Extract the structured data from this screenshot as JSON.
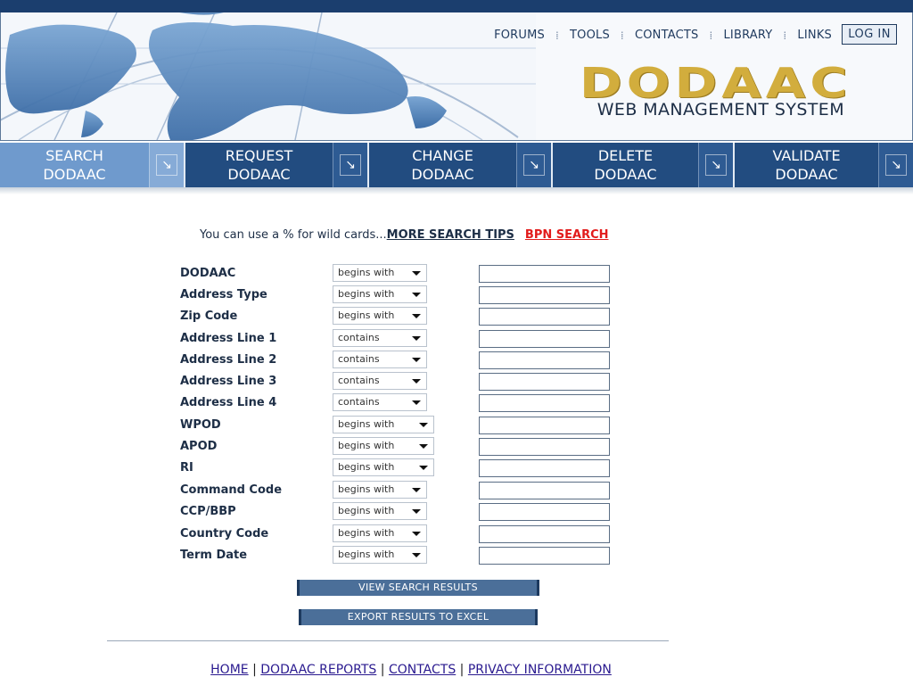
{
  "header": {
    "nav": [
      "FORUMS",
      "TOOLS",
      "CONTACTS",
      "LIBRARY",
      "LINKS"
    ],
    "login_label": "LOG IN",
    "brand": "DODAAC",
    "brand_subtitle": "WEB MANAGEMENT SYSTEM"
  },
  "tabs": [
    {
      "line1": "SEARCH",
      "line2": "DODAAC",
      "active": true
    },
    {
      "line1": "REQUEST",
      "line2": "DODAAC",
      "active": false
    },
    {
      "line1": "CHANGE",
      "line2": "DODAAC",
      "active": false
    },
    {
      "line1": "DELETE",
      "line2": "DODAAC",
      "active": false
    },
    {
      "line1": "VALIDATE",
      "line2": "DODAAC",
      "active": false
    }
  ],
  "search": {
    "tip_text": "You can use a % for wild cards...",
    "more_tips_link": "MORE SEARCH TIPS",
    "bpn_link": "BPN SEARCH",
    "fields": [
      {
        "label": "DODAAC",
        "operator": "begins with",
        "value": ""
      },
      {
        "label": "Address Type",
        "operator": "begins with",
        "value": ""
      },
      {
        "label": "Zip Code",
        "operator": "begins with",
        "value": ""
      },
      {
        "label": "Address Line 1",
        "operator": "contains",
        "value": ""
      },
      {
        "label": "Address Line 2",
        "operator": "contains",
        "value": ""
      },
      {
        "label": "Address Line 3",
        "operator": "contains",
        "value": ""
      },
      {
        "label": "Address Line 4",
        "operator": "contains",
        "value": ""
      },
      {
        "label": "WPOD",
        "operator": "begins with",
        "value": ""
      },
      {
        "label": "APOD",
        "operator": "begins with",
        "value": ""
      },
      {
        "label": "RI",
        "operator": "begins with",
        "value": ""
      },
      {
        "label": "Command Code",
        "operator": "begins with",
        "value": ""
      },
      {
        "label": "CCP/BBP",
        "operator": "begins with",
        "value": ""
      },
      {
        "label": "Country Code",
        "operator": "begins with",
        "value": ""
      },
      {
        "label": "Term Date",
        "operator": "begins with",
        "value": ""
      }
    ],
    "view_button": "VIEW SEARCH RESULTS",
    "export_button": "EXPORT RESULTS TO EXCEL"
  },
  "footer": {
    "links": [
      "HOME",
      "DODAAC REPORTS",
      "CONTACTS",
      "PRIVACY INFORMATION"
    ],
    "separator": "|"
  },
  "colors": {
    "top_bar": "#1b3e6e",
    "tab_active": "#6f9acd",
    "tab_normal": "#224c80",
    "brand_gold": "#d2ad3d",
    "bpn_link": "#e21b1b",
    "button": "#4b6f99"
  },
  "icons": [
    "globe-map-graphic",
    "arrow-down-right-icon",
    "dropdown-caret-icon"
  ]
}
